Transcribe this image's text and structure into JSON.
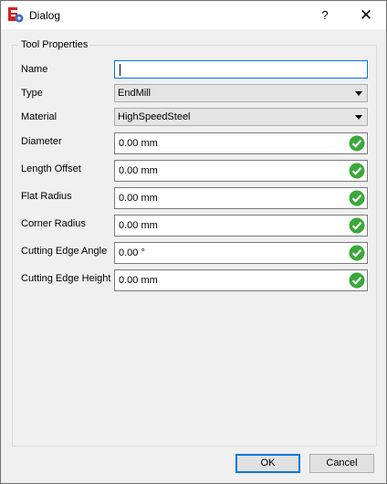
{
  "window": {
    "title": "Dialog",
    "help_label": "?",
    "close_label": "✕"
  },
  "group": {
    "title": "Tool Properties"
  },
  "fields": {
    "name": {
      "label": "Name",
      "value": ""
    },
    "type": {
      "label": "Type",
      "value": "EndMill"
    },
    "material": {
      "label": "Material",
      "value": "HighSpeedSteel"
    },
    "diameter": {
      "label": "Diameter",
      "value": "0.00 mm"
    },
    "length_offset": {
      "label": "Length Offset",
      "value": "0.00 mm"
    },
    "flat_radius": {
      "label": "Flat Radius",
      "value": "0.00 mm"
    },
    "corner_radius": {
      "label": "Corner Radius",
      "value": "0.00 mm"
    },
    "cutting_edge_angle": {
      "label": "Cutting Edge Angle",
      "value": "0.00 °"
    },
    "cutting_edge_height": {
      "label": "Cutting Edge Height",
      "value": "0.00 mm"
    }
  },
  "buttons": {
    "ok": "OK",
    "cancel": "Cancel"
  },
  "colors": {
    "accent": "#0078d7",
    "valid": "#3aa83a"
  },
  "icons": {
    "app": "freecad-icon",
    "valid": "checkmark-icon",
    "dropdown": "chevron-down-icon"
  }
}
